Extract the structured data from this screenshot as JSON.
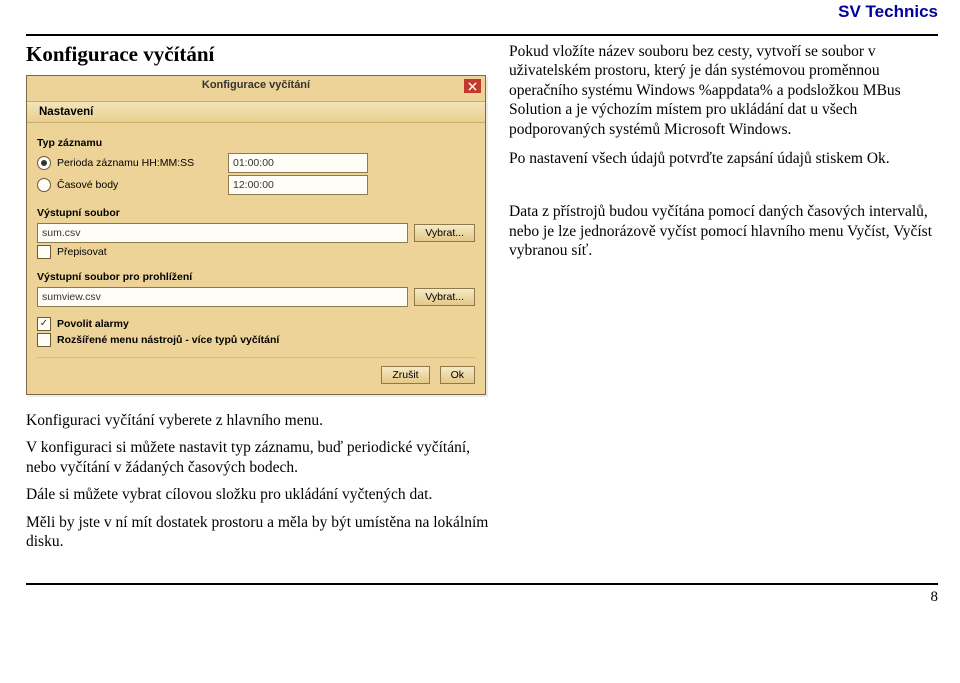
{
  "brand": "SV Technics",
  "page_number": "8",
  "heading_left": "Konfigurace vyčítání",
  "right_paragraphs": {
    "p1": "Pokud vložíte název souboru bez cesty, vytvoří se soubor v uživatelském prostoru, který je dán systémovou proměnnou operačního systému Windows %appdata% a podsložkou MBus Solution a je výchozím místem pro ukládání dat u všech podporovaných systémů Microsoft Windows.",
    "p2": "Po nastavení všech údajů potvrďte zapsání údajů stiskem Ok.",
    "p3": "Data z přístrojů budou vyčítána pomocí daných časových intervalů, nebo je lze jednorázově vyčíst pomocí hlavního menu Vyčíst, Vyčíst vybranou síť."
  },
  "below": {
    "p1": "Konfiguraci vyčítání vyberete z hlavního menu.",
    "p2": "V konfiguraci si můžete nastavit typ záznamu, buď periodické vyčítání, nebo vyčítání v žádaných časových bodech.",
    "p3": "Dále si můžete vybrat cílovou složku pro ukládání vyčtených dat.",
    "p4": "Měli by jste v ní mít dostatek prostoru a měla by být umístěna na lokálním disku."
  },
  "dialog": {
    "title": "Konfigurace vyčítání",
    "tab": "Nastavení",
    "group_type": "Typ záznamu",
    "radio1_label": "Perioda záznamu HH:MM:SS",
    "radio1_value": "01:00:00",
    "radio2_label": "Časové body",
    "radio2_value": "12:00:00",
    "group_out": "Výstupní soubor",
    "out_value": "sum.csv",
    "browse": "Vybrat...",
    "overwrite": "Přepisovat",
    "group_view": "Výstupní soubor pro prohlížení",
    "view_value": "sumview.csv",
    "allow_alarms": "Povolit alarmy",
    "extended_menu": "Rozšířené menu nástrojů - více typů vyčítání",
    "cancel": "Zrušit",
    "ok": "Ok"
  }
}
